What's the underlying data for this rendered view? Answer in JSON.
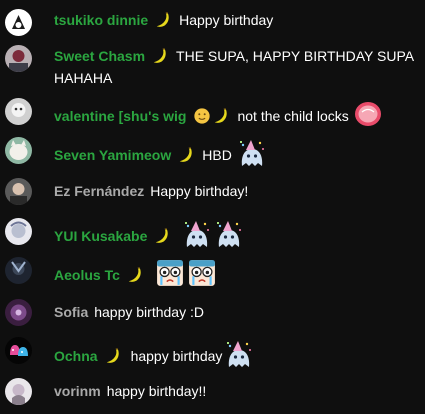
{
  "colors": {
    "background": "#0f0f0f",
    "member_name": "#2ba640",
    "plain_name": "#aaaaaa",
    "message": "#ffffff"
  },
  "messages": [
    {
      "author": "tsukiko dinnie",
      "member": true,
      "badges": [
        "banana-icon"
      ],
      "text": "Happy birthday"
    },
    {
      "author": "Sweet Chasm",
      "member": true,
      "badges": [
        "banana-icon"
      ],
      "text": "THE SUPA, HAPPY BIRTHDAY SUPA HAHAHA"
    },
    {
      "author": "valentine [shu's wig",
      "member": true,
      "badges": [
        "smiley-emoji",
        "banana-icon"
      ],
      "text": "not the child locks",
      "trailing_emoji": [
        "pink-candy-emoji"
      ]
    },
    {
      "author": "Seven Yamimeow",
      "member": true,
      "badges": [
        "banana-icon"
      ],
      "text": "HBD",
      "trailing_emoji": [
        "party-ghost-emoji"
      ]
    },
    {
      "author": "Ez Fernández",
      "member": false,
      "badges": [],
      "text": "Happy birthday!"
    },
    {
      "author": "YUI Kusakabe",
      "member": true,
      "badges": [
        "banana-icon"
      ],
      "text": "",
      "trailing_emoji": [
        "party-ghost-emoji",
        "party-ghost-emoji"
      ]
    },
    {
      "author": "Aeolus Tc",
      "member": true,
      "badges": [
        "banana-icon"
      ],
      "text": "",
      "trailing_emoji": [
        "crying-face-emoji",
        "crying-face-emoji"
      ]
    },
    {
      "author": "Sofia",
      "member": false,
      "badges": [],
      "text": "happy birthday :D"
    },
    {
      "author": "Ochna",
      "member": true,
      "badges": [
        "banana-icon"
      ],
      "text": "happy birthday",
      "trailing_emoji": [
        "party-ghost-emoji"
      ]
    },
    {
      "author": "vorinm",
      "member": false,
      "badges": [],
      "text": "happy birthday!!"
    }
  ]
}
